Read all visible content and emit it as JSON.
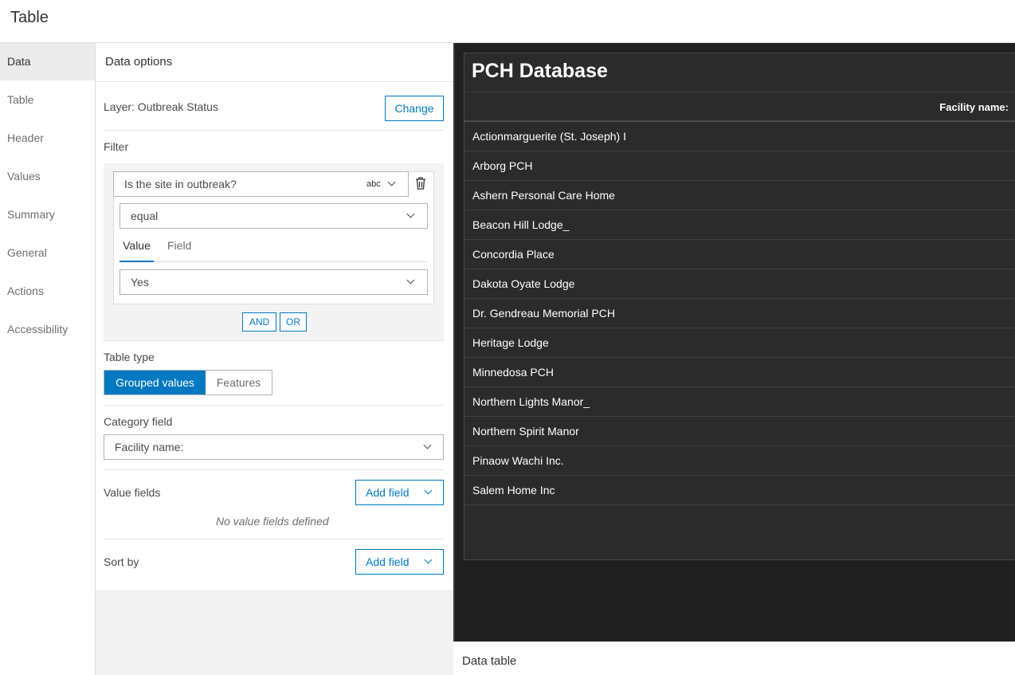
{
  "app": {
    "title": "Table"
  },
  "tabs": [
    {
      "label": "Data"
    },
    {
      "label": "Table"
    },
    {
      "label": "Header"
    },
    {
      "label": "Values"
    },
    {
      "label": "Summary"
    },
    {
      "label": "General"
    },
    {
      "label": "Actions"
    },
    {
      "label": "Accessibility"
    }
  ],
  "panel": {
    "title": "Data options",
    "layer_label": "Layer: Outbreak Status",
    "change_button": "Change",
    "filter_label": "Filter",
    "filter": {
      "field": "Is the site in outbreak?",
      "field_type_icon": "abc",
      "operator": "equal",
      "value_tab": "Value",
      "field_tab": "Field",
      "value": "Yes",
      "and_button": "AND",
      "or_button": "OR"
    },
    "table_type_label": "Table type",
    "table_type_options": [
      "Grouped values",
      "Features"
    ],
    "table_type_selected": "Grouped values",
    "category_field_label": "Category field",
    "category_field_value": "Facility name:",
    "value_fields_label": "Value fields",
    "add_field_button": "Add field",
    "no_value_fields": "No value fields defined",
    "sort_by_label": "Sort by",
    "sort_add_field_button": "Add field"
  },
  "preview": {
    "title": "PCH Database",
    "column_header": "Facility name:",
    "rows": [
      "Actionmarguerite (St. Joseph) I",
      "Arborg PCH",
      "Ashern Personal Care Home",
      "Beacon Hill Lodge_",
      "Concordia Place",
      "Dakota Oyate Lodge",
      "Dr. Gendreau Memorial PCH",
      "Heritage Lodge",
      "Minnedosa PCH",
      "Northern Lights Manor_",
      "Northern Spirit Manor",
      "Pinaow Wachi Inc.",
      "Salem Home Inc"
    ],
    "footer": "Data table"
  },
  "colors": {
    "accent": "#0079c1",
    "preview_bg": "#202020",
    "card_bg": "#2b2b2b"
  }
}
